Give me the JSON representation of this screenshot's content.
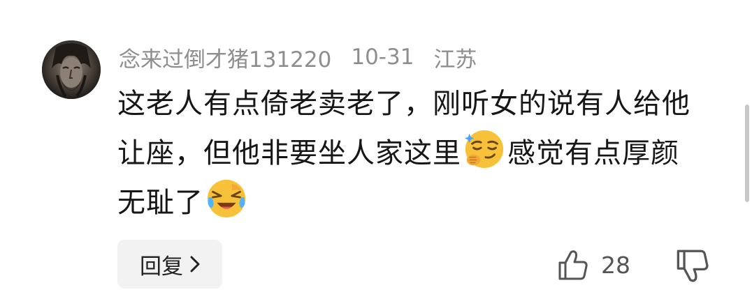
{
  "comment": {
    "username": "念来过倒才猪131220",
    "date": "10-31",
    "location": "江苏",
    "text_part1": "这老人有点倚老卖老了，刚听女的说有人给他让座，但他非要坐人家这里",
    "text_part2": "感觉有点厚颜无耻了",
    "emoji_1": "smirk-emoji",
    "emoji_2": "laughing-crying-emoji",
    "reply_label": "回复",
    "like_count": "28"
  }
}
